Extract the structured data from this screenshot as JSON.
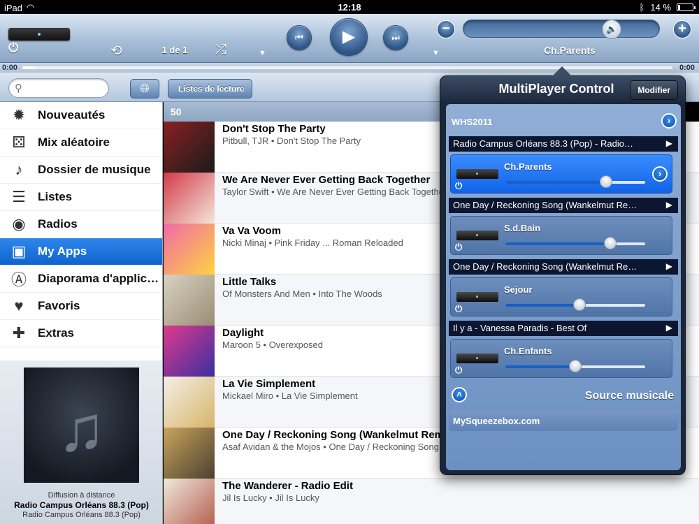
{
  "statusbar": {
    "carrier": "iPad",
    "time": "12:18",
    "battery": "14 %",
    "battery_level": 0.14
  },
  "player": {
    "counter": "1 de 1",
    "current_player": "Ch.Parents",
    "volume_level": 0.78,
    "progress_start": "0:00",
    "progress_end": "0:00",
    "progress_level": 0.02
  },
  "toolbar": {
    "search_placeholder": "",
    "back_label": "Listes de lecture"
  },
  "sidebar": {
    "items": [
      {
        "label": "Nouveautés",
        "icon": "new-releases-icon"
      },
      {
        "label": "Mix aléatoire",
        "icon": "dice-icon"
      },
      {
        "label": "Dossier de musique",
        "icon": "music-folder-icon"
      },
      {
        "label": "Listes",
        "icon": "list-icon"
      },
      {
        "label": "Radios",
        "icon": "radio-icon"
      },
      {
        "label": "My Apps",
        "icon": "apps-icon"
      },
      {
        "label": "Diaporama d'applic…",
        "icon": "slideshow-icon"
      },
      {
        "label": "Favoris",
        "icon": "heart-icon"
      },
      {
        "label": "Extras",
        "icon": "plus-icon"
      }
    ],
    "active_index": 5
  },
  "nowplaying": {
    "line1": "Diffusion à distance",
    "line2": "Radio Campus Orléans 88.3 (Pop)",
    "line3": "Radio Campus Orléans 88.3 (Pop)"
  },
  "list": {
    "count": "50",
    "songs": [
      {
        "title": "Don't Stop The Party",
        "meta": "Pitbull, TJR • Don't Stop The Party",
        "color1": "#8a2020",
        "color2": "#1a1a1a"
      },
      {
        "title": "We Are Never Ever Getting Back Together",
        "meta": "Taylor Swift • We Are Never Ever Getting Back Together",
        "color1": "#d43a4a",
        "color2": "#f3e7d8"
      },
      {
        "title": "Va Va Voom",
        "meta": "Nicki Minaj • Pink Friday ... Roman Reloaded",
        "color1": "#f06aa8",
        "color2": "#ffd23f"
      },
      {
        "title": "Little Talks",
        "meta": "Of Monsters And Men • Into The Woods",
        "color1": "#d9d2c2",
        "color2": "#9a8d74"
      },
      {
        "title": "Daylight",
        "meta": "Maroon 5 • Overexposed",
        "color1": "#e03a8c",
        "color2": "#3a2fa0"
      },
      {
        "title": "La Vie Simplement",
        "meta": "Mickael Miro • La Vie Simplement",
        "color1": "#f3efe6",
        "color2": "#d8b46a"
      },
      {
        "title": "One Day / Reckoning Song (Wankelmut Rem",
        "meta": "Asaf Avidan & the Mojos • One Day / Reckoning Song (",
        "color1": "#c9a45c",
        "color2": "#4b4030"
      },
      {
        "title": "The Wanderer - Radio Edit",
        "meta": "Jil Is Lucky • Jil Is Lucky",
        "color1": "#efe8dd",
        "color2": "#b35b4a"
      }
    ]
  },
  "multiplayer": {
    "title": "MultiPlayer Control",
    "modify_label": "Modifier",
    "server": "WHS2011",
    "groups": [
      {
        "nowplaying": "Radio Campus Orléans 88.3 (Pop) - Radio…",
        "player": "Ch.Parents",
        "volume": 0.72,
        "selected": true
      },
      {
        "nowplaying": "One Day / Reckoning Song (Wankelmut Re…",
        "player": "S.d.Bain",
        "volume": 0.75,
        "selected": false
      },
      {
        "nowplaying": "One Day / Reckoning Song (Wankelmut Re…",
        "player": "Sejour",
        "volume": 0.53,
        "selected": false
      },
      {
        "nowplaying": "Il y a - Vanessa Paradis - Best Of",
        "player": "Ch.Enfants",
        "volume": 0.5,
        "selected": false
      }
    ],
    "source_label": "Source musicale",
    "source_item": "MySqueezebox.com"
  }
}
